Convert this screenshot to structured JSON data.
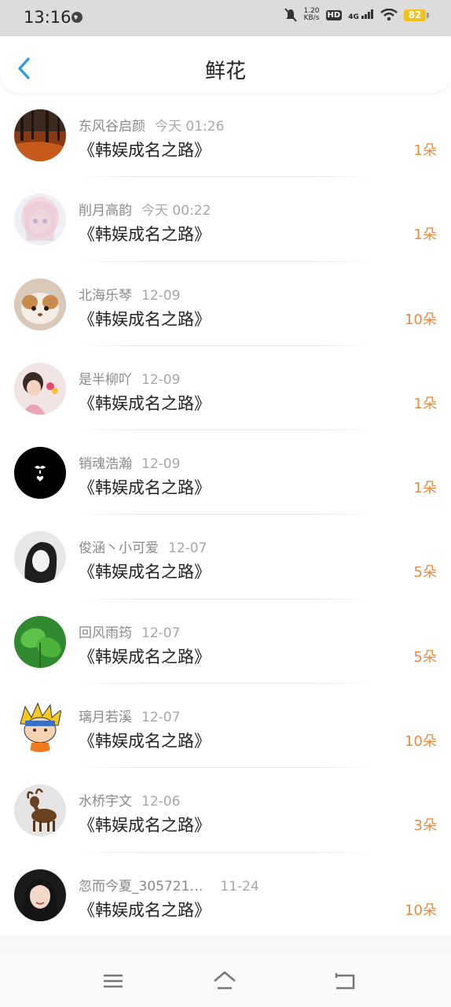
{
  "status": {
    "time": "13:16",
    "net_speed_value": "1.20",
    "net_speed_unit": "KB/s",
    "hd": "HD",
    "signal": "4G",
    "battery": "82"
  },
  "header": {
    "title": "鲜花"
  },
  "items": [
    {
      "name": "东风谷启颜",
      "date": "今天 01:26",
      "book": "《韩娱成名之路》",
      "count": "1朵"
    },
    {
      "name": "削月高韵",
      "date": "今天 00:22",
      "book": "《韩娱成名之路》",
      "count": "1朵"
    },
    {
      "name": "北海乐琴",
      "date": "12-09",
      "book": "《韩娱成名之路》",
      "count": "10朵"
    },
    {
      "name": "是半柳吖",
      "date": "12-09",
      "book": "《韩娱成名之路》",
      "count": "1朵"
    },
    {
      "name": "销魂浩瀚",
      "date": "12-09",
      "book": "《韩娱成名之路》",
      "count": "1朵"
    },
    {
      "name": "俊涵丶小可爱",
      "date": "12-07",
      "book": "《韩娱成名之路》",
      "count": "5朵"
    },
    {
      "name": "回风雨筠",
      "date": "12-07",
      "book": "《韩娱成名之路》",
      "count": "5朵"
    },
    {
      "name": "璃月若溪",
      "date": "12-07",
      "book": "《韩娱成名之路》",
      "count": "10朵"
    },
    {
      "name": "水桥宇文",
      "date": "12-06",
      "book": "《韩娱成名之路》",
      "count": "3朵"
    },
    {
      "name": "忽而今夏_305721…",
      "date": "11-24",
      "book": "《韩娱成名之路》",
      "count": "10朵"
    }
  ],
  "colors": {
    "accent": "#2a9be8",
    "count": "#e88a3e"
  }
}
